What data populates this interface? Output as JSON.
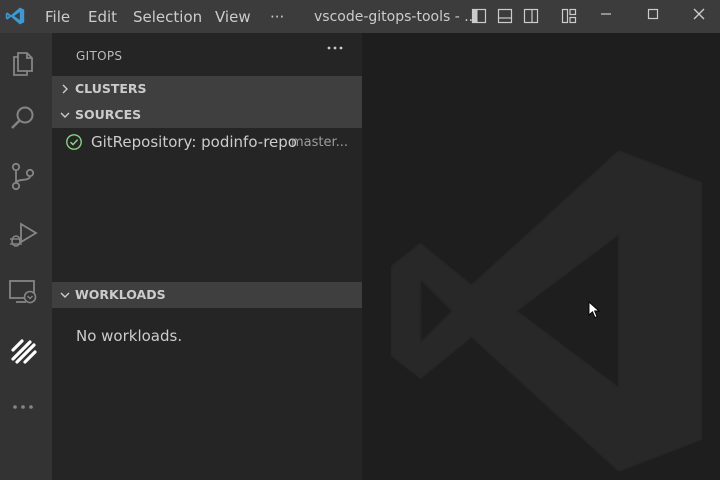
{
  "titlebar": {
    "menu": [
      "File",
      "Edit",
      "Selection",
      "View",
      "···"
    ],
    "window_title": "vscode-gitops-tools - ..."
  },
  "activity_bar": {
    "icons": [
      "explorer-icon",
      "search-icon",
      "source-control-icon",
      "run-debug-icon",
      "remote-explorer-icon",
      "gitops-icon",
      "more-icon"
    ],
    "active_icon": "gitops-icon"
  },
  "sidebar": {
    "title": "GITOPS",
    "sections": {
      "clusters": {
        "label": "CLUSTERS",
        "expanded": false
      },
      "sources": {
        "label": "SOURCES",
        "expanded": true,
        "items": [
          {
            "label": "GitRepository: podinfo-repo",
            "description": "master...",
            "status_icon": "check-circle-icon"
          }
        ]
      },
      "workloads": {
        "label": "WORKLOADS",
        "expanded": true,
        "empty_message": "No workloads."
      }
    }
  },
  "colors": {
    "titlebar_bg": "#3c3c3c",
    "activitybar_bg": "#333333",
    "sidebar_bg": "#252526",
    "section_header_bg": "#3f3f3f",
    "editor_bg": "#1e1e1e",
    "accent_blue": "#3c99d4",
    "status_ok": "#89d185"
  }
}
